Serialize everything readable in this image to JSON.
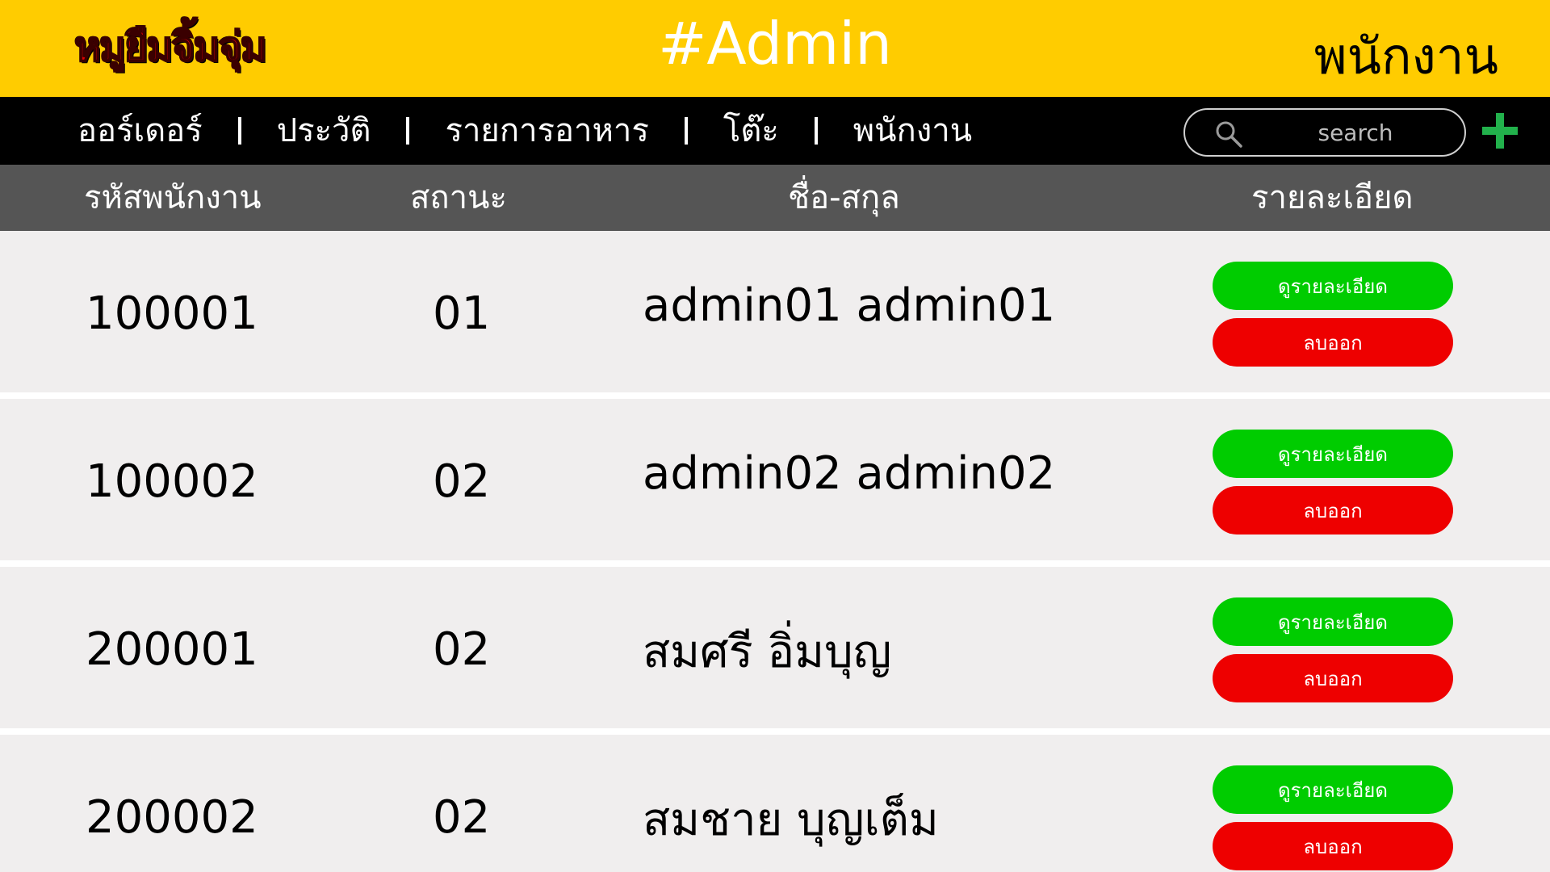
{
  "header": {
    "logo_text": "หมูยืมจิ้มจุ่ม",
    "app_title": "#Admin",
    "page_title": "พนักงาน"
  },
  "nav": {
    "items": [
      {
        "label": "ออร์เดอร์"
      },
      {
        "label": "ประวัติ"
      },
      {
        "label": "รายการอาหาร"
      },
      {
        "label": "โต๊ะ"
      },
      {
        "label": "พนักงาน"
      }
    ]
  },
  "search": {
    "placeholder": "search"
  },
  "table": {
    "headers": {
      "id": "รหัสพนักงาน",
      "status": "สถานะ",
      "name": "ชื่อ-สกุล",
      "details": "รายละเอียด"
    },
    "rows": [
      {
        "id": "100001",
        "status": "01",
        "name": "admin01 admin01",
        "view_label": "ดูรายละเอียด",
        "delete_label": "ลบออก"
      },
      {
        "id": "100002",
        "status": "02",
        "name": "admin02 admin02",
        "view_label": "ดูรายละเอียด",
        "delete_label": "ลบออก"
      },
      {
        "id": "200001",
        "status": "02",
        "name": "สมศรี  อิ่มบุญ",
        "view_label": "ดูรายละเอียด",
        "delete_label": "ลบออก"
      },
      {
        "id": "200002",
        "status": "02",
        "name": "สมชาย  บุญเต็ม",
        "view_label": "ดูรายละเอียด",
        "delete_label": "ลบออก"
      }
    ]
  },
  "colors": {
    "header_bg": "#ffcc00",
    "nav_bg": "#000000",
    "table_header_bg": "#555555",
    "row_bg": "#f0eeee",
    "view_button": "#00cc00",
    "delete_button": "#ee0000",
    "add_icon": "#22b14c"
  },
  "icons": {
    "search": "search-icon",
    "add": "plus-icon"
  }
}
